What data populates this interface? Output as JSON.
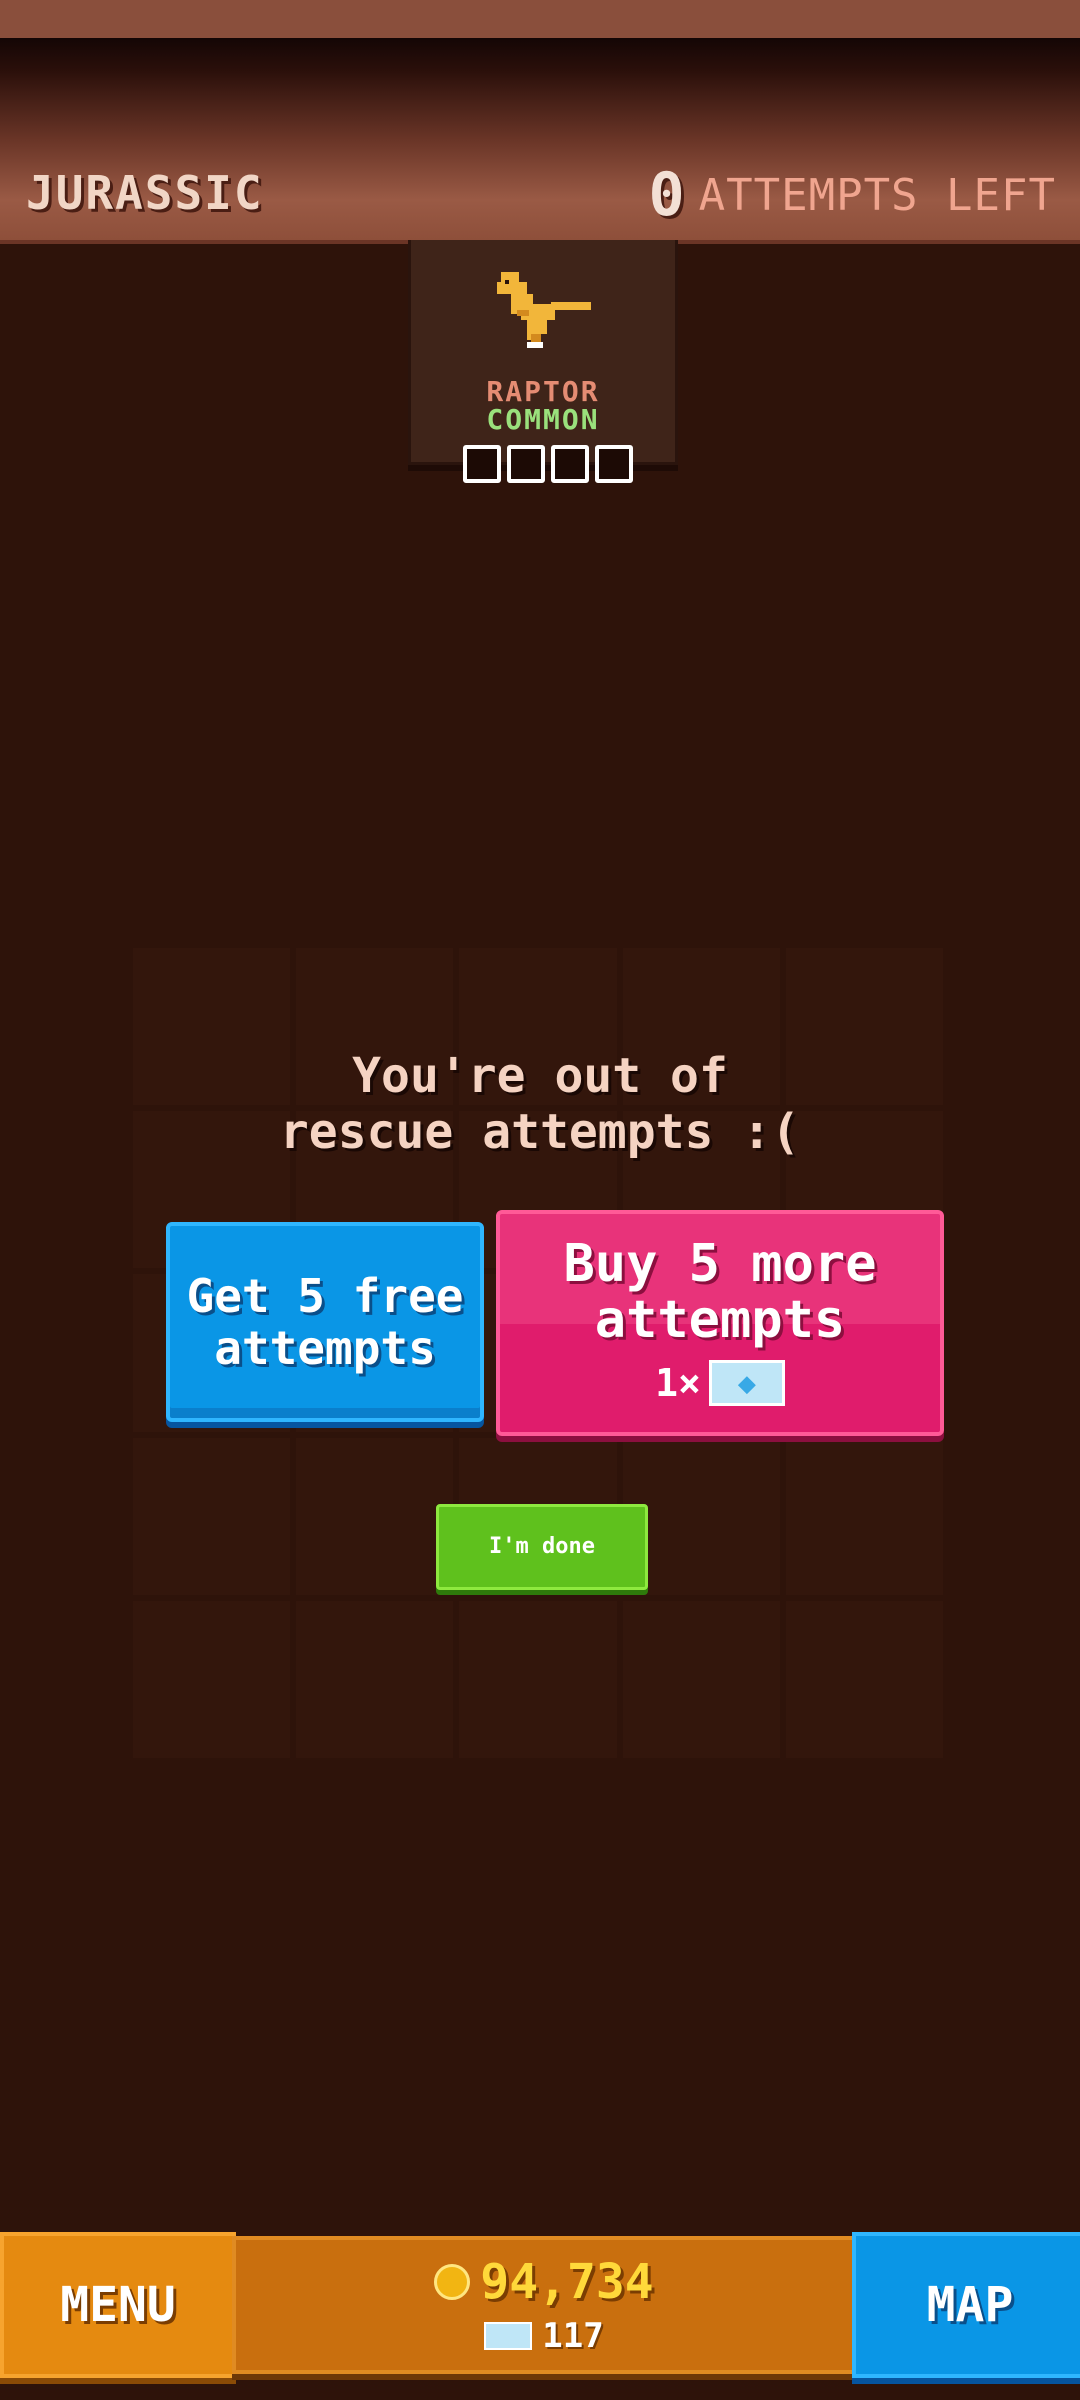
{
  "header": {
    "era": "JURASSIC",
    "attempts_left_count": "0",
    "attempts_left_label": "ATTEMPTS LEFT"
  },
  "dino_card": {
    "name": "RAPTOR",
    "rarity": "COMMON",
    "progress_filled": 0,
    "progress_total": 4
  },
  "dialog": {
    "message_line1": "You're out of",
    "message_line2": "rescue attempts :(",
    "free_button": "Get 5 free attempts",
    "buy_button": "Buy 5 more attempts",
    "buy_cost": "1×",
    "done_button": "I'm done"
  },
  "footer": {
    "menu_label": "MENU",
    "coins": "94,734",
    "gems": "117",
    "map_label": "MAP"
  }
}
